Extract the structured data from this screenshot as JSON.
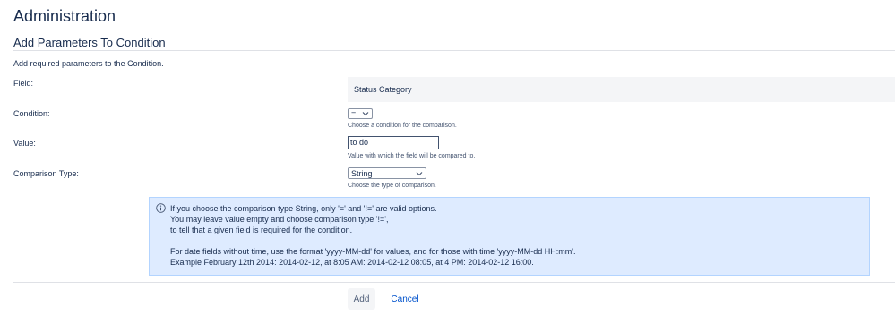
{
  "page": {
    "title": "Administration"
  },
  "section": {
    "title": "Add Parameters To Condition",
    "intro": "Add required parameters to the Condition."
  },
  "form": {
    "field": {
      "label": "Field:",
      "value": "Status Category"
    },
    "condition": {
      "label": "Condition:",
      "selected": "=",
      "help": "Choose a condition for the comparison."
    },
    "value": {
      "label": "Value:",
      "current": "to do",
      "help": "Value with which the field will be compared to."
    },
    "comparison_type": {
      "label": "Comparison Type:",
      "selected": "String",
      "help": "Choose the type of comparison."
    }
  },
  "info": {
    "icon": "info-circle-icon",
    "lines": [
      "If you choose the comparison type String, only '=' and '!=' are valid options.",
      "You may leave value empty and choose comparison type '!=',",
      "to tell that a given field is required for the condition.",
      "",
      "For date fields without time, use the format 'yyyy-MM-dd' for values, and for those with time 'yyyy-MM-dd HH:mm'.",
      "Example February 12th 2014: 2014-02-12, at 8:05 AM: 2014-02-12 08:05, at 4 PM: 2014-02-12 16:00."
    ]
  },
  "actions": {
    "add_label": "Add",
    "cancel_label": "Cancel"
  },
  "colors": {
    "info_background": "#deebff",
    "info_border": "#b3d4ff",
    "link": "#0052cc",
    "text": "#172b4d"
  }
}
